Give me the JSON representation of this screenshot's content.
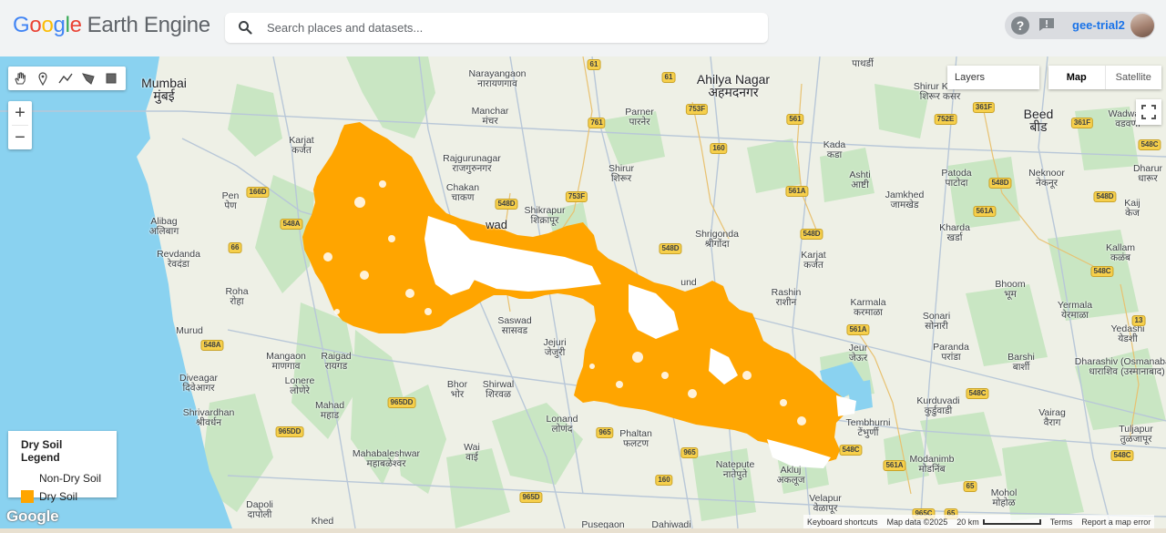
{
  "brand": {
    "letters": [
      "G",
      "o",
      "o",
      "g",
      "l",
      "e"
    ],
    "product": "Earth Engine"
  },
  "search": {
    "placeholder": "Search places and datasets..."
  },
  "account": {
    "username": "gee-trial2",
    "help_label": "?"
  },
  "toolbar": {
    "tools": [
      "hand-icon",
      "marker-icon",
      "line-icon",
      "polygon-icon",
      "rectangle-icon"
    ]
  },
  "zoom": {
    "in": "+",
    "out": "−"
  },
  "layers": {
    "label": "Layers"
  },
  "map_type": {
    "options": [
      "Map",
      "Satellite"
    ],
    "selected": "Map"
  },
  "legend": {
    "title": "Dry Soil Legend",
    "items": [
      {
        "label": "Non-Dry Soil",
        "color": "#ffffff"
      },
      {
        "label": "Dry Soil",
        "color": "#ffa500"
      }
    ]
  },
  "places": [
    {
      "name": "Mumbai",
      "local": "मुंबई",
      "big": true
    },
    {
      "name": "Ahilya Nagar",
      "local": "अहमदनगर",
      "big": true
    },
    {
      "name": "Beed",
      "local": "बीड",
      "big": true
    },
    {
      "name": "Narayangaon",
      "local": "नारायणगाव"
    },
    {
      "name": "Manchar",
      "local": "मंचर"
    },
    {
      "name": "Parner",
      "local": "पारनेर"
    },
    {
      "name": "Karjat",
      "local": "कर्जत"
    },
    {
      "name": "Rajgurunagar",
      "local": "राजगुरुनगर"
    },
    {
      "name": "Shirur",
      "local": "शिरूर"
    },
    {
      "name": "Chakan",
      "local": "चाकण"
    },
    {
      "name": "Shikrapur",
      "local": "शिक्रापूर"
    },
    {
      "name": "Pen",
      "local": "पेण"
    },
    {
      "name": "Alibag",
      "local": "अलिबाग"
    },
    {
      "name": "Revdanda",
      "local": "रेवदंडा"
    },
    {
      "name": "Roha",
      "local": "रोहा"
    },
    {
      "name": "Murud",
      "local": ""
    },
    {
      "name": "Mangaon",
      "local": "माणगाव"
    },
    {
      "name": "Raigad",
      "local": "रायगड"
    },
    {
      "name": "Lonere",
      "local": "लोणेरे"
    },
    {
      "name": "Diveagar",
      "local": "दिवेआगर"
    },
    {
      "name": "Mahad",
      "local": "महाड"
    },
    {
      "name": "Shrivardhan",
      "local": "श्रीवर्धन"
    },
    {
      "name": "Mahabaleshwar",
      "local": "महाबळेश्वर"
    },
    {
      "name": "Dapoli",
      "local": "दापोली"
    },
    {
      "name": "Khed",
      "local": ""
    },
    {
      "name": "Saswad",
      "local": "सासवड"
    },
    {
      "name": "Jejuri",
      "local": "जेजुरी"
    },
    {
      "name": "Bhor",
      "local": "भोर"
    },
    {
      "name": "Shirwal",
      "local": "शिरवळ"
    },
    {
      "name": "Wai",
      "local": "वाई"
    },
    {
      "name": "Lonand",
      "local": "लोणंद"
    },
    {
      "name": "Phaltan",
      "local": "फलटण"
    },
    {
      "name": "Natepute",
      "local": "नातेपुते"
    },
    {
      "name": "Akluj",
      "local": "अकलूज"
    },
    {
      "name": "Velapur",
      "local": "वेळापूर"
    },
    {
      "name": "Pusegaon",
      "local": ""
    },
    {
      "name": "Dahiwadi",
      "local": ""
    },
    {
      "name": "Shrigonda",
      "local": "श्रीगोंदा"
    },
    {
      "name": "Kada",
      "local": "कडा"
    },
    {
      "name": "Ashti",
      "local": "आष्टी"
    },
    {
      "name": "Karjat",
      "local": "कर्जत"
    },
    {
      "name": "Rashin",
      "local": "राशीन"
    },
    {
      "name": "Karmala",
      "local": "करमाळा"
    },
    {
      "name": "Jeur",
      "local": "जेऊर"
    },
    {
      "name": "Tembhurni",
      "local": "टेंभुर्णी"
    },
    {
      "name": "Kurduvadi",
      "local": "कुर्डुवाडी"
    },
    {
      "name": "Modanimb",
      "local": "मोडनिंब"
    },
    {
      "name": "Mohol",
      "local": "मोहोळ"
    },
    {
      "name": "Sonari",
      "local": "सोनारी"
    },
    {
      "name": "Paranda",
      "local": "परांडा"
    },
    {
      "name": "Barshi",
      "local": "बार्शी"
    },
    {
      "name": "Bhoom",
      "local": "भूम"
    },
    {
      "name": "Kharda",
      "local": "खर्डा"
    },
    {
      "name": "Jamkhed",
      "local": "जामखेड"
    },
    {
      "name": "Patoda",
      "local": "पाटोदा"
    },
    {
      "name": "Neknoor",
      "local": "नेकनूर"
    },
    {
      "name": "Shirur Kasar",
      "local": "शिरूर कसर"
    },
    {
      "name": "Wadwani",
      "local": "वडवणी"
    },
    {
      "name": "Dharur",
      "local": "धारूर"
    },
    {
      "name": "Kaij",
      "local": "केज"
    },
    {
      "name": "Kallam",
      "local": "कळंब"
    },
    {
      "name": "Yermala",
      "local": "येरमाळा"
    },
    {
      "name": "Yedashi",
      "local": "येडशी"
    },
    {
      "name": "Dharashiv (Osmanabad)",
      "local": "धाराशिव (उस्मानाबाद)"
    },
    {
      "name": "Vairag",
      "local": "वैराग"
    },
    {
      "name": "Tuljapur",
      "local": "तुळजापूर"
    },
    {
      "name": "Pathardi",
      "local": "पाथर्डी"
    }
  ],
  "partial_labels": {
    "wad": "wad",
    "und": "und"
  },
  "shields": [
    "61",
    "61",
    "761",
    "753F",
    "160",
    "561",
    "561A",
    "548D",
    "548D",
    "548D",
    "166D",
    "548A",
    "66",
    "548A",
    "965DD",
    "965DD",
    "965",
    "965",
    "160",
    "965D",
    "753F",
    "752E",
    "361F",
    "361F",
    "548C",
    "548D",
    "548D",
    "548C",
    "548C",
    "561A",
    "561A",
    "65",
    "548C",
    "548C",
    "965C",
    "65",
    "13"
  ],
  "footer": {
    "google": "Google",
    "shortcuts": "Keyboard shortcuts",
    "data": "Map data ©2025",
    "scale": "20 km",
    "terms": "Terms",
    "report": "Report a map error"
  },
  "colors": {
    "dry": "#ffa500",
    "water": "#8ad2f0",
    "land": "#eef0e6",
    "forest": "#c9e6c3"
  }
}
